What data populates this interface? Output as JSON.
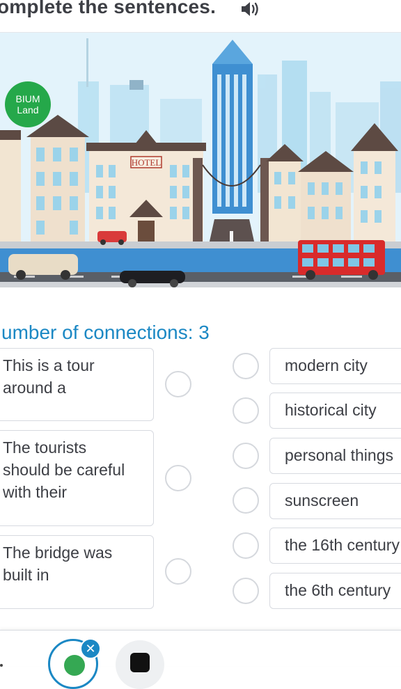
{
  "header": {
    "title": "omplete the sentences.",
    "speaker_icon": "speaker-icon"
  },
  "illustration": {
    "brand_line1": "BIUM",
    "brand_line2": "Land",
    "hotel_sign": "HOTEL"
  },
  "connections_label": "umber of connections: 3",
  "prompts": [
    {
      "lines": [
        "This is a tour",
        "around a"
      ]
    },
    {
      "lines": [
        "The tourists",
        "should be careful",
        "with their"
      ]
    },
    {
      "lines": [
        "The bridge was",
        "built in"
      ]
    }
  ],
  "answers": [
    {
      "label": "modern city"
    },
    {
      "label": "historical city"
    },
    {
      "label": "personal things"
    },
    {
      "label": "sunscreen"
    },
    {
      "label": "the 16th century"
    },
    {
      "label": "the 6th century"
    }
  ],
  "bottom_bar": {
    "close_symbol": "✕",
    "icons": [
      "avatar-icon",
      "close-icon",
      "bicycle-icon"
    ]
  },
  "colors": {
    "accent": "#1b88c4",
    "brand_green": "#25a84a",
    "text": "#3d3f45",
    "border": "#d7dae0"
  }
}
